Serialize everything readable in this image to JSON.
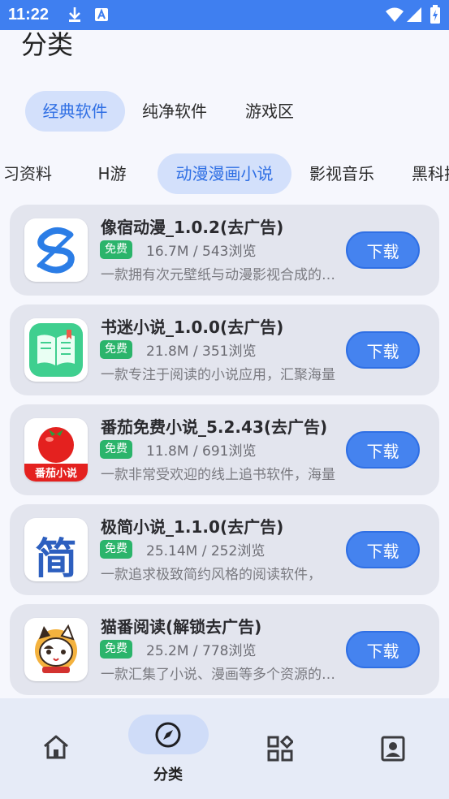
{
  "status_bar": {
    "time": "11:22"
  },
  "page": {
    "title": "分类"
  },
  "category_tabs": [
    {
      "label": "经典软件",
      "active": true
    },
    {
      "label": "纯净软件",
      "active": false
    },
    {
      "label": "游戏区",
      "active": false
    }
  ],
  "sub_tabs": [
    {
      "label": "习资料",
      "active": false
    },
    {
      "label": "H游",
      "active": false
    },
    {
      "label": "动漫漫画小说",
      "active": true
    },
    {
      "label": "影视音乐",
      "active": false
    },
    {
      "label": "黑科技",
      "active": false
    }
  ],
  "apps": [
    {
      "name": "像宿动漫_1.0.2(去广告)",
      "badge": "免费",
      "meta": "16.7M / 543浏览",
      "desc": "一款拥有次元壁纸与动漫影视合成的软件",
      "button": "下载",
      "icon": "swirl-logo-icon"
    },
    {
      "name": "书迷小说_1.0.0(去广告)",
      "badge": "免费",
      "meta": "21.8M / 351浏览",
      "desc": "一款专注于阅读的小说应用，汇聚海量",
      "button": "下载",
      "icon": "green-book-icon"
    },
    {
      "name": "番茄免费小说_5.2.43(去广告)",
      "badge": "免费",
      "meta": "11.8M / 691浏览",
      "desc": "一款非常受欢迎的线上追书软件，海量",
      "button": "下载",
      "icon": "tomato-icon",
      "icon_text": "番茄小说"
    },
    {
      "name": "极简小说_1.1.0(去广告)",
      "badge": "免费",
      "meta": "25.14M / 252浏览",
      "desc": "一款追求极致简约风格的阅读软件，",
      "button": "下载",
      "icon": "jian-character-icon",
      "icon_text": "简"
    },
    {
      "name": "猫番阅读(解锁去广告)",
      "badge": "免费",
      "meta": "25.2M / 778浏览",
      "desc": "一款汇集了小说、漫画等多个资源的软件",
      "button": "下载",
      "icon": "cat-mascot-icon"
    }
  ],
  "bottom_nav": {
    "items": [
      {
        "icon": "home-icon",
        "label": ""
      },
      {
        "icon": "compass-icon",
        "label": "分类",
        "active": true
      },
      {
        "icon": "apps-grid-icon",
        "label": ""
      },
      {
        "icon": "profile-icon",
        "label": ""
      }
    ]
  },
  "colors": {
    "status_bar": "#3f7ff0",
    "accent": "#2f6fe4",
    "download_button": "#4583ef",
    "free_badge": "#2bb46b"
  }
}
